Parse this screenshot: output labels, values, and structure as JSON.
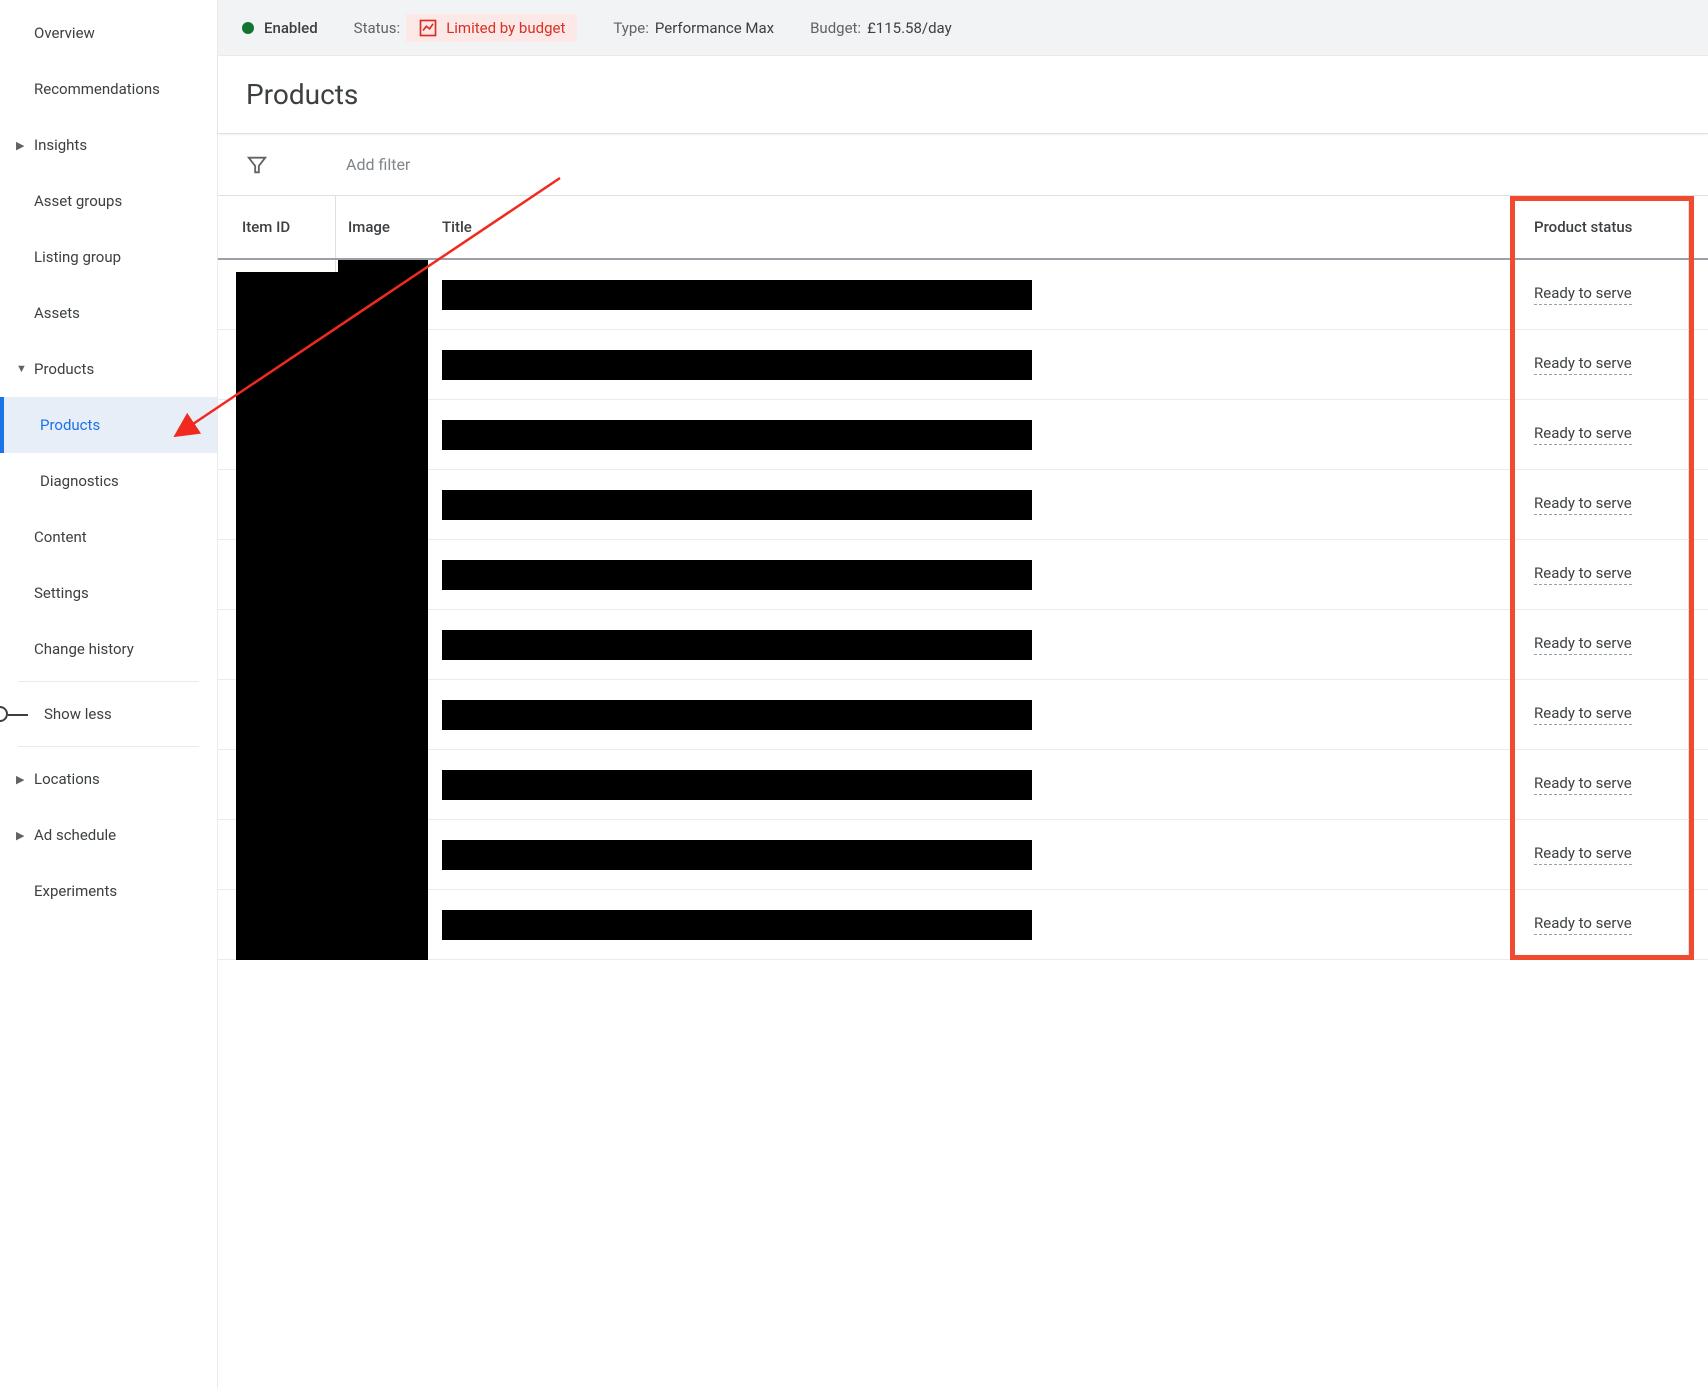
{
  "topbar": {
    "enabled": "Enabled",
    "status_label": "Status:",
    "status_value": "Limited by budget",
    "type_label": "Type:",
    "type_value": "Performance Max",
    "budget_label": "Budget:",
    "budget_value": "£115.58/day"
  },
  "page": {
    "title": "Products",
    "add_filter": "Add filter"
  },
  "sidebar": {
    "overview": "Overview",
    "recommendations": "Recommendations",
    "insights": "Insights",
    "asset_groups": "Asset groups",
    "listing_group": "Listing group",
    "assets": "Assets",
    "products": "Products",
    "products_sub": "Products",
    "diagnostics": "Diagnostics",
    "content": "Content",
    "settings": "Settings",
    "change_history": "Change history",
    "show_less": "Show less",
    "locations": "Locations",
    "ad_schedule": "Ad schedule",
    "experiments": "Experiments"
  },
  "table": {
    "headers": {
      "item_id": "Item ID",
      "image": "Image",
      "title": "Title",
      "status": "Product status"
    },
    "rows": [
      {
        "status": "Ready to serve"
      },
      {
        "status": "Ready to serve"
      },
      {
        "status": "Ready to serve"
      },
      {
        "status": "Ready to serve"
      },
      {
        "status": "Ready to serve"
      },
      {
        "status": "Ready to serve"
      },
      {
        "status": "Ready to serve"
      },
      {
        "status": "Ready to serve"
      },
      {
        "status": "Ready to serve"
      },
      {
        "status": "Ready to serve"
      }
    ]
  }
}
